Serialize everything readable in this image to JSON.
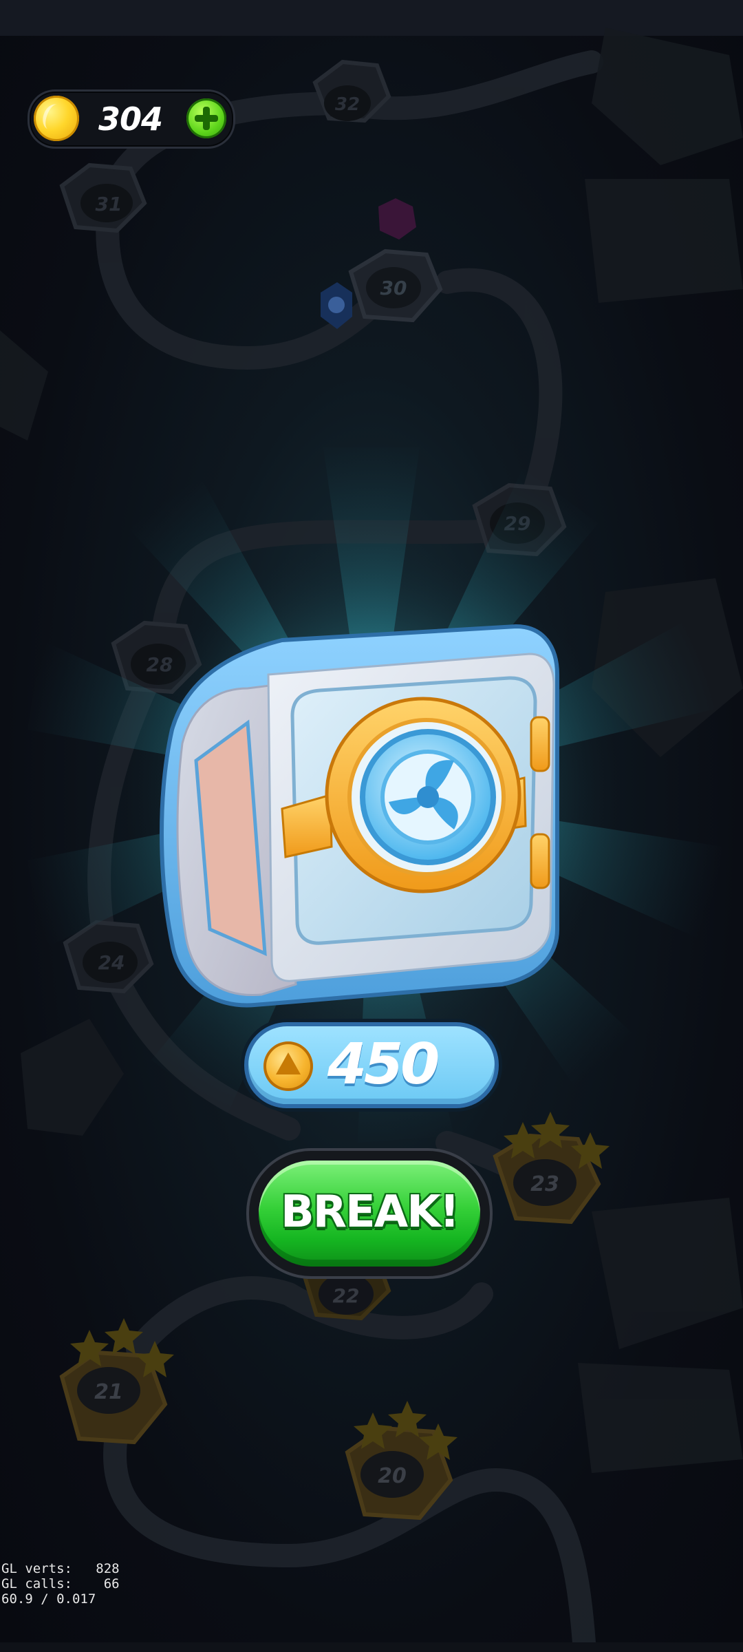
{
  "hud": {
    "coins": "304",
    "coin_icon": "gold-coin-icon",
    "add_icon": "plus-icon"
  },
  "map": {
    "levels": [
      "32",
      "31",
      "30",
      "29",
      "28",
      "24",
      "23",
      "22",
      "21",
      "20"
    ],
    "star_icon": "star-icon",
    "skull_icon": "skull-icon"
  },
  "reward": {
    "amount": "450",
    "coin_icon": "coin-icon"
  },
  "break_button": {
    "label": "BREAK!"
  },
  "debug": {
    "line1": "GL verts:   828",
    "line2": "GL calls:    66",
    "line3": "60.9 / 0.017"
  },
  "colors": {
    "background": "#0b0e15",
    "glow": "#2a8f9e",
    "reward_pill": "#7dd3f7",
    "break_green": "#2ecc3a",
    "safe_blue": "#5aaee8",
    "safe_gold": "#f7a92a"
  }
}
